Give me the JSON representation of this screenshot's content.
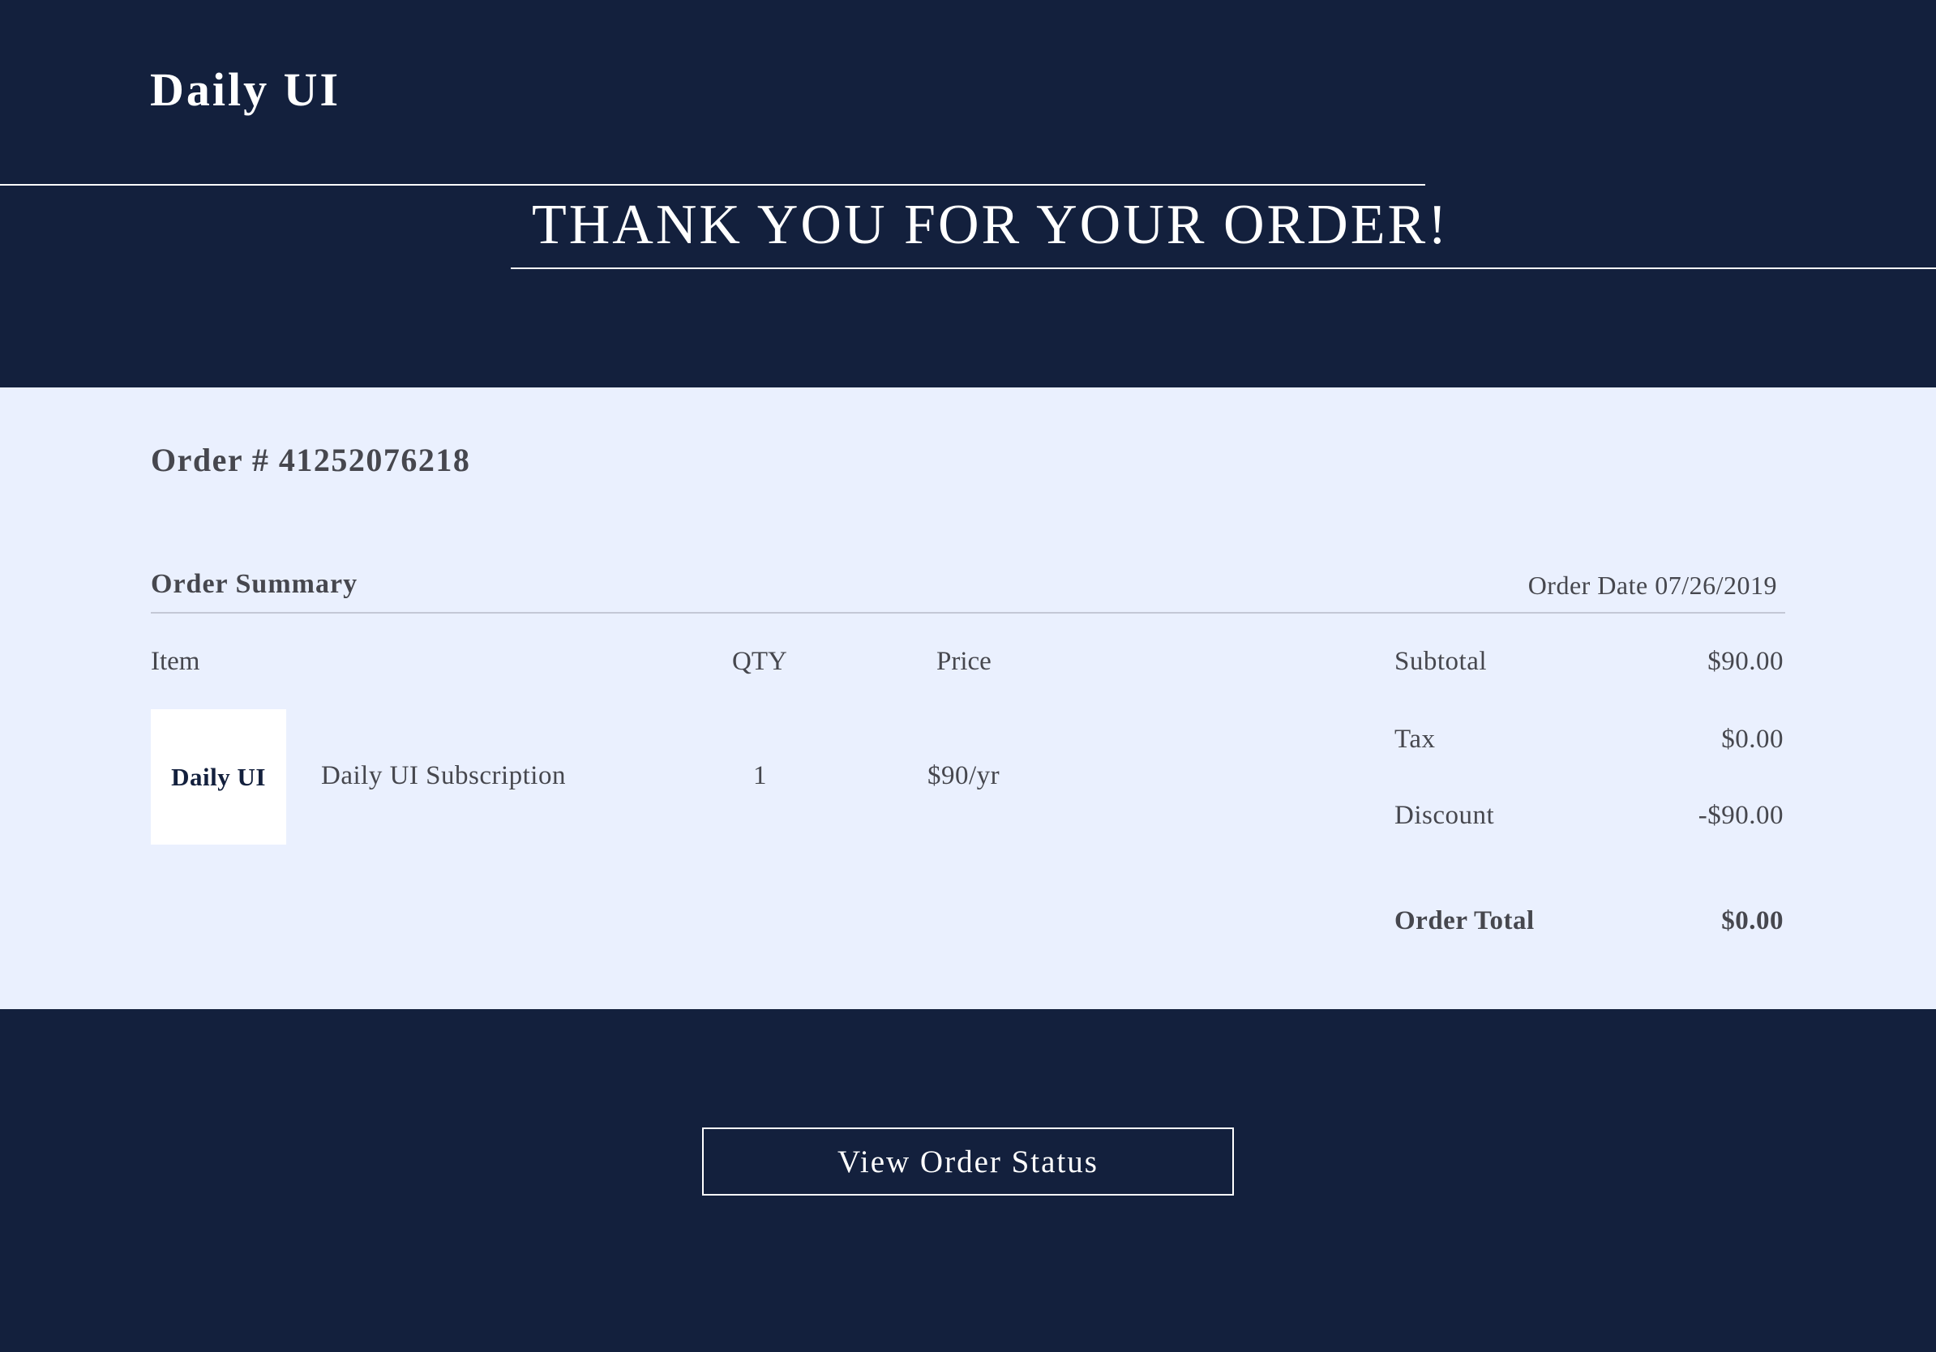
{
  "header": {
    "brand": "Daily UI",
    "headline": "THANK YOU FOR YOUR ORDER!"
  },
  "order": {
    "number_label": "Order # 41252076218",
    "summary_title": "Order Summary",
    "date_label": "Order Date 07/26/2019",
    "columns": {
      "item": "Item",
      "qty": "QTY",
      "price": "Price"
    },
    "items": [
      {
        "thumb_label": "Daily UI",
        "name": "Daily UI Subscription",
        "qty": "1",
        "price": "$90/yr"
      }
    ],
    "totals": [
      {
        "label": "Subtotal",
        "value": "$90.00"
      },
      {
        "label": "Tax",
        "value": "$0.00"
      },
      {
        "label": "Discount",
        "value": "-$90.00"
      },
      {
        "label": "Order Total",
        "value": "$0.00"
      }
    ]
  },
  "footer": {
    "button_label": "View Order Status"
  },
  "colors": {
    "navy": "#13203d",
    "light_panel": "#eaf0fe",
    "text_gray": "#46474e",
    "white": "#ffffff"
  }
}
